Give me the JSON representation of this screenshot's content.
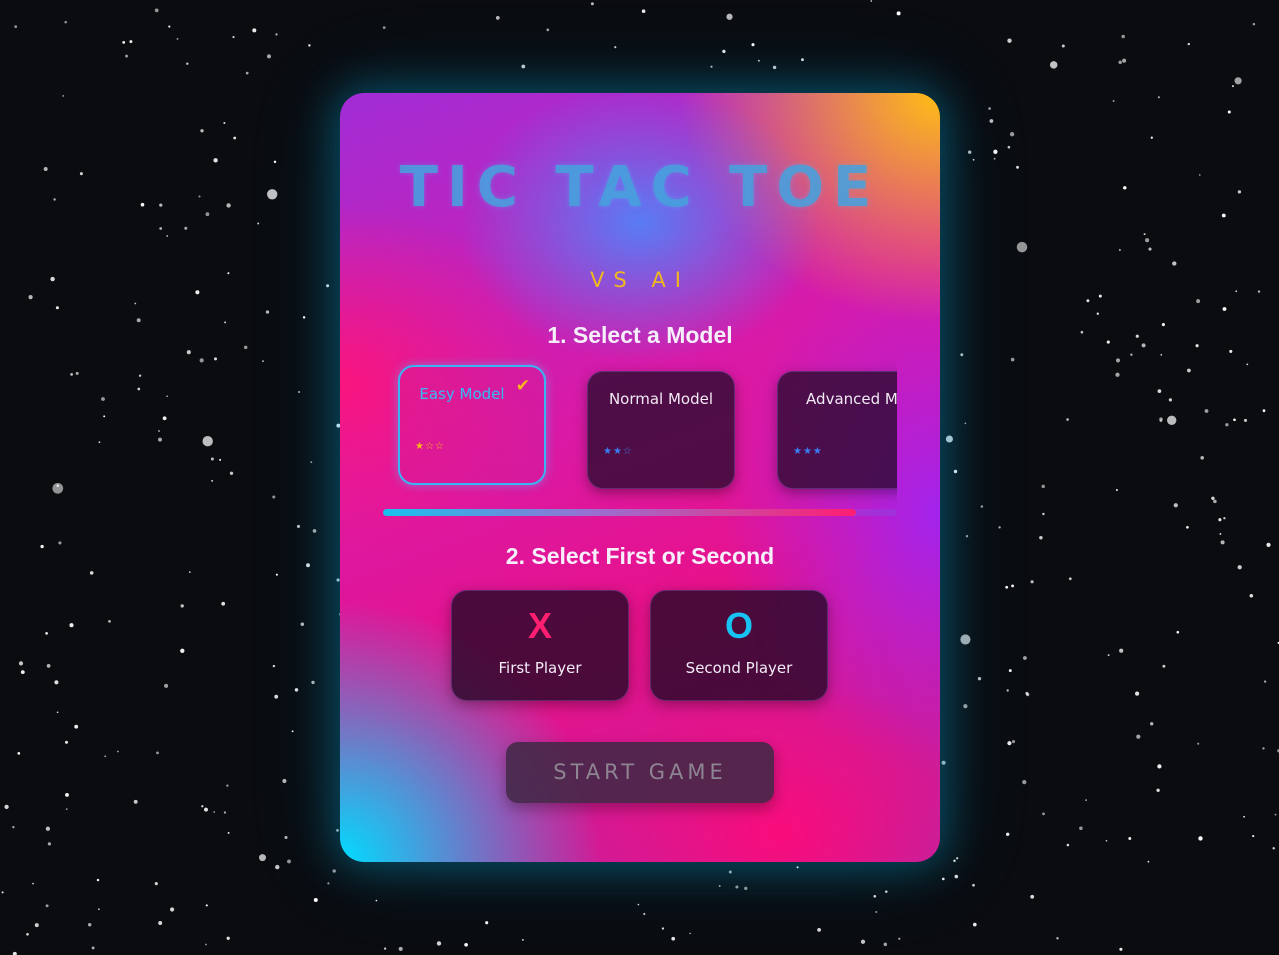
{
  "header": {
    "title": "TIC TAC TOE",
    "subtitle": "VS AI"
  },
  "model_section": {
    "title": "1. Select a Model",
    "selected_index": 0,
    "models": [
      {
        "label": "Easy Model",
        "rating": 1,
        "max_rating": 3,
        "stars": "★☆☆"
      },
      {
        "label": "Normal Model",
        "rating": 2,
        "max_rating": 3,
        "stars": "★★☆"
      },
      {
        "label": "Advanced Model",
        "rating": 3,
        "max_rating": 3,
        "stars": "★★★"
      }
    ],
    "selected_mark": "✔",
    "scroll_fraction": 0.92
  },
  "turn_section": {
    "title": "2. Select First or Second",
    "options": [
      {
        "symbol": "X",
        "label": "First Player",
        "color": "#ff1e70"
      },
      {
        "symbol": "O",
        "label": "Second Player",
        "color": "#16c3f3"
      }
    ]
  },
  "start_button": {
    "label": "START GAME",
    "disabled": true
  },
  "colors": {
    "accent_cyan": "#35b9f5",
    "accent_gold": "#f4b81c",
    "accent_pink": "#ff1e70",
    "background": "#0a0c10"
  },
  "icons": {
    "selected_check": "check-icon",
    "rating": "star-icon"
  }
}
